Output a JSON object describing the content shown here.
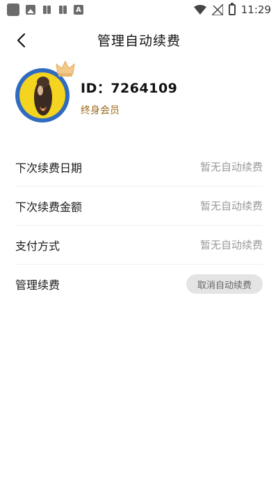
{
  "status_bar": {
    "time": "11:29",
    "left_icons": [
      "app-icon",
      "image-icon",
      "cards-icon",
      "cards-icon",
      "font-icon"
    ],
    "letter_icon_text": "A",
    "right_icons": [
      "wifi-icon",
      "no-signal-icon",
      "battery-charging-icon"
    ]
  },
  "header": {
    "title": "管理自动续费",
    "back_icon": "chevron-left-icon"
  },
  "profile": {
    "id_label": "ID：7264109",
    "membership": "终身会员",
    "badge_icon": "crown-icon"
  },
  "settings": [
    {
      "label": "下次续费日期",
      "value": "暂无自动续费"
    },
    {
      "label": "下次续费金额",
      "value": "暂无自动续费"
    },
    {
      "label": "支付方式",
      "value": "暂无自动续费"
    },
    {
      "label": "管理续费",
      "button_label": "取消自动续费"
    }
  ],
  "colors": {
    "membership_text": "#9a6a1a",
    "value_text": "#9a9a9a",
    "cancel_button_bg": "#e4e4e4",
    "avatar_ring": "#2f6cc0",
    "avatar_bg": "#f5d41f",
    "crown": "#f3c98a"
  }
}
